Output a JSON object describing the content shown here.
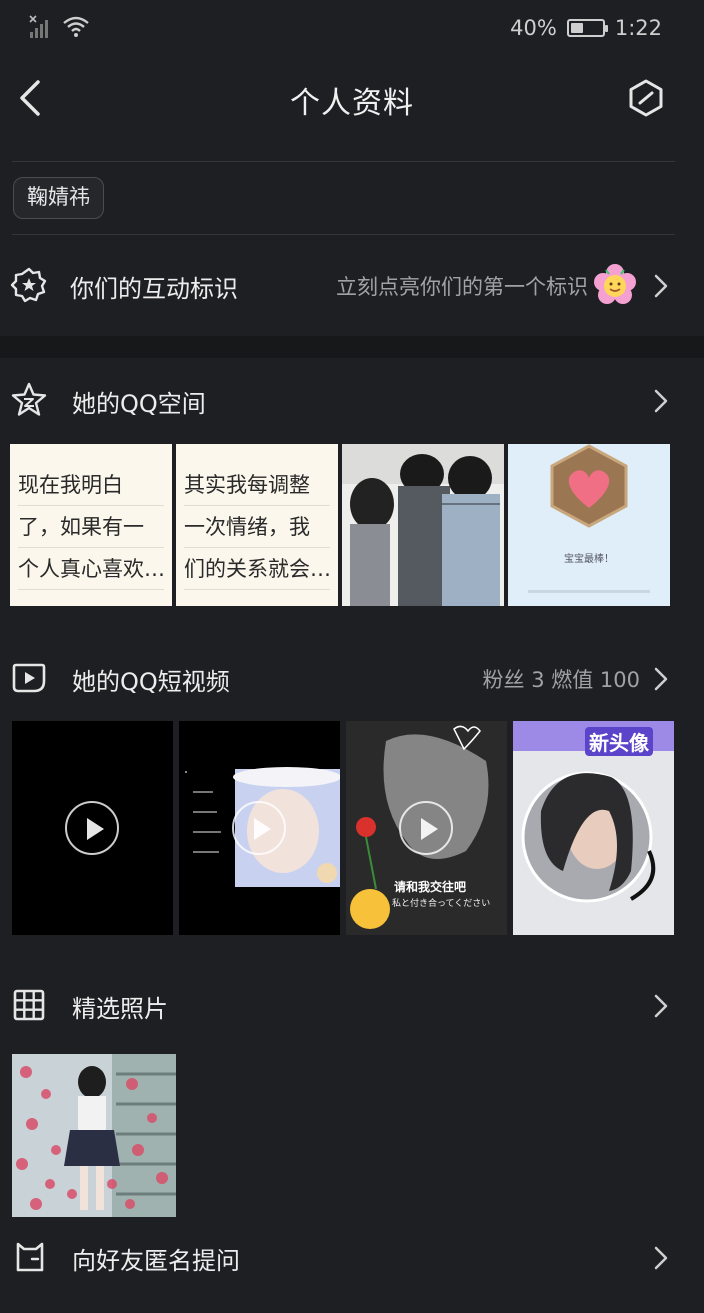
{
  "status": {
    "battery": "40%",
    "time": "1:22",
    "battery_level": 0.4
  },
  "nav": {
    "title": "个人资料"
  },
  "tag": "鞠婧祎",
  "interaction": {
    "label": "你们的互动标识",
    "hint": "立刻点亮你们的第一个标识"
  },
  "qzone": {
    "label": "她的QQ空间",
    "cards": [
      {
        "lines": [
          "现在我明白",
          "了，如果有一",
          "个人真心喜欢…"
        ]
      },
      {
        "lines": [
          "其实我每调整",
          "一次情绪，我",
          "们的关系就会…"
        ]
      }
    ],
    "badge_caption": "宝宝最棒！"
  },
  "short_video": {
    "label": "她的QQ短视频",
    "stats": "粉丝 3  燃值 100",
    "video3_caption": "请和我交往吧",
    "video3_subcaption": "私と付き合ってください",
    "video4_title": "新头像"
  },
  "photos": {
    "label": "精选照片"
  },
  "anon": {
    "label": "向好友匿名提问"
  }
}
